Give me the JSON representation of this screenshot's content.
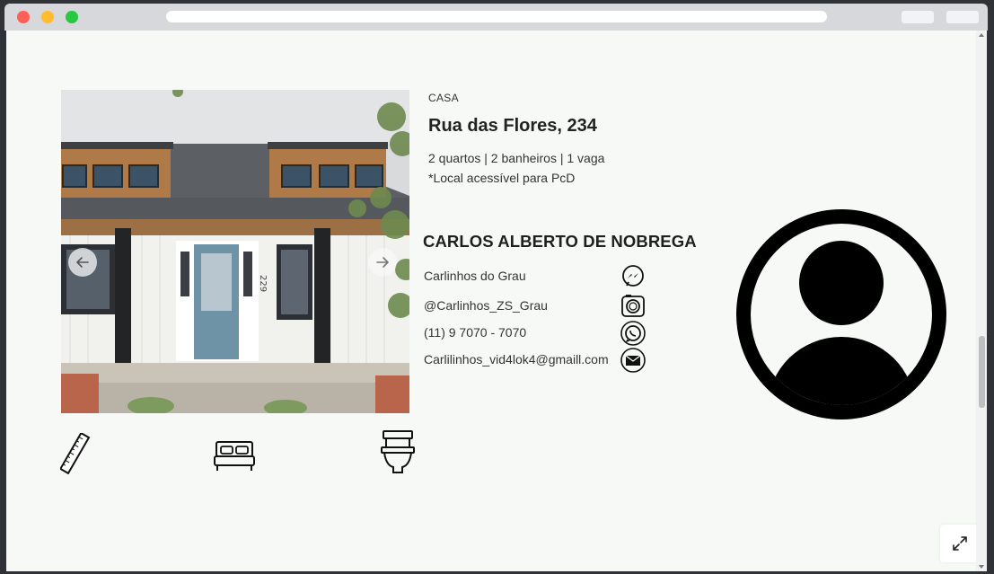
{
  "listing": {
    "property_type": "CASA",
    "address": "Rua das Flores, 234",
    "details": "2 quartos | 2 banheiros | 1 vaga",
    "accessibility": "*Local acessível para PcD",
    "house_number": "229"
  },
  "gallery": {
    "prev_icon": "arrow-left-icon",
    "next_icon": "arrow-right-icon"
  },
  "features": [
    "ruler-icon",
    "bed-icon",
    "toilet-icon"
  ],
  "agent": {
    "name": "CARLOS ALBERTO DE NOBREGA",
    "contacts": [
      {
        "text": "Carlinhos do Grau",
        "icon": "messenger-icon"
      },
      {
        "text": "@Carlinhos_ZS_Grau",
        "icon": "instagram-icon"
      },
      {
        "text": "(11) 9 7070 - 7070",
        "icon": "whatsapp-icon"
      },
      {
        "text": "Carlilinhos_vid4lok4@gmaill.com",
        "icon": "mail-icon"
      }
    ]
  },
  "colors": {
    "page_bg": "#f7f9f7",
    "text": "#333333",
    "chrome": "#d6d8dc"
  }
}
